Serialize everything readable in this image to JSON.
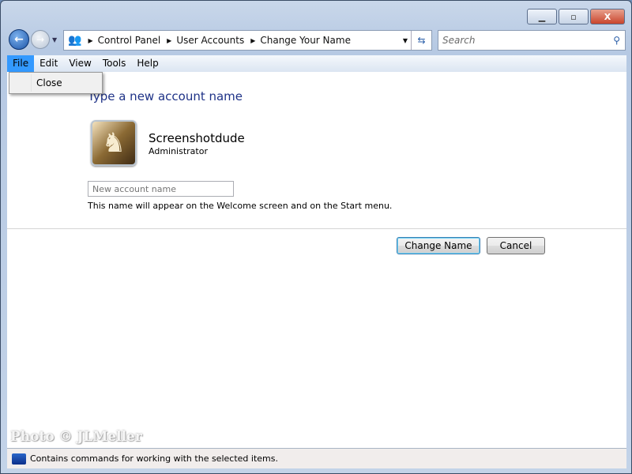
{
  "window": {
    "minimize": "▁",
    "maximize": "▫",
    "close": "X"
  },
  "nav": {
    "back_icon": "arrow-left",
    "forward_icon": "arrow-right"
  },
  "breadcrumb": [
    "Control Panel",
    "User Accounts",
    "Change Your Name"
  ],
  "search": {
    "placeholder": "Search"
  },
  "menu": [
    "File",
    "Edit",
    "View",
    "Tools",
    "Help"
  ],
  "file_menu": {
    "items": [
      "Close"
    ]
  },
  "main": {
    "title": "Type a new account name",
    "user_name": "Screenshotdude",
    "user_role": "Administrator",
    "name_input_placeholder": "New account name",
    "hint": "This name will appear on the Welcome screen and on the Start menu.",
    "change_button": "Change Name",
    "cancel_button": "Cancel"
  },
  "status": {
    "text": "Contains commands for working with the selected items."
  },
  "watermark": "Photo © JLMeller"
}
